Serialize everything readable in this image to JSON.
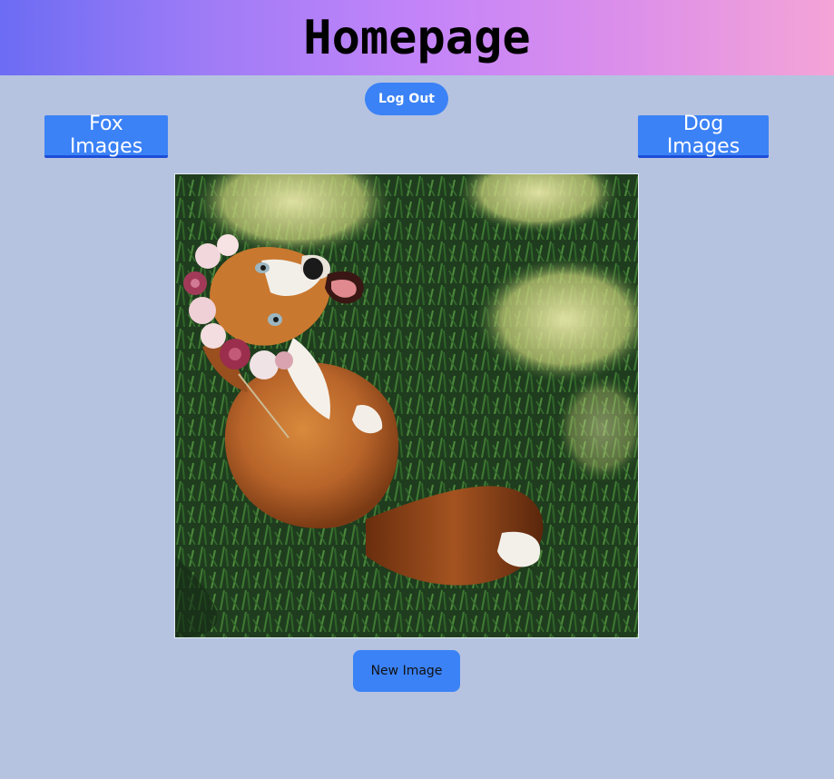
{
  "header": {
    "title": "Homepage"
  },
  "auth": {
    "logout_label": "Log Out"
  },
  "nav": {
    "fox_label": "Fox Images",
    "dog_label": "Dog Images"
  },
  "gallery": {
    "image_subject": "fox-with-flower-crown-on-grass",
    "new_image_label": "New Image"
  },
  "colors": {
    "page_bg": "#b5c3e0",
    "button_blue": "#3b82f6",
    "gradient_start": "#6c6cf4",
    "gradient_end": "#f4a4d6"
  }
}
